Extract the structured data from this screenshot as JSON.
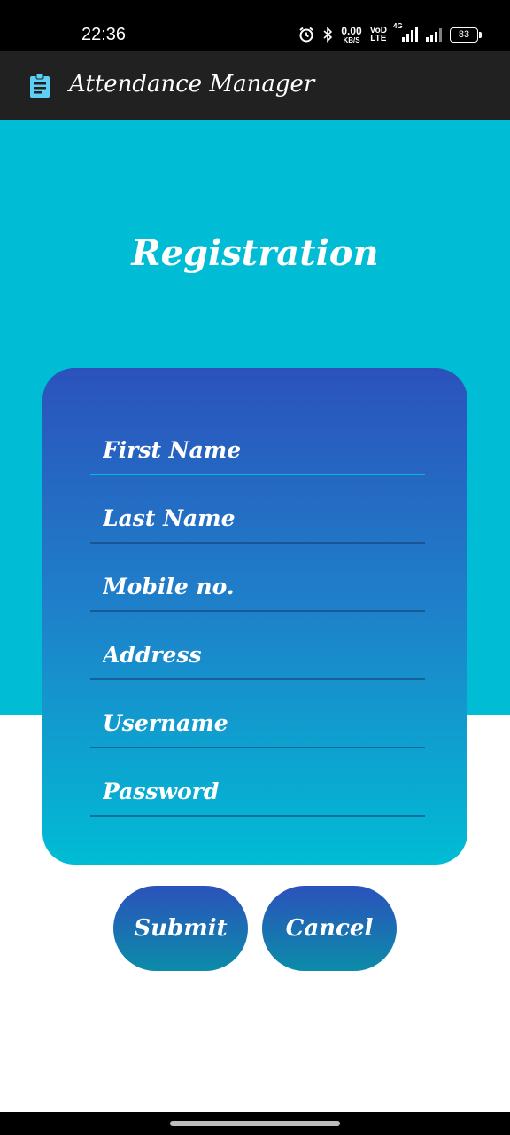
{
  "status_bar": {
    "time": "22:36",
    "net_speed_value": "0.00",
    "net_speed_unit": "KB/S",
    "volte_top": "VoD",
    "volte_bottom": "LTE",
    "network_type": "4G",
    "battery": "83"
  },
  "app_bar": {
    "title": "Attendance Manager",
    "icon": "clipboard-icon"
  },
  "screen": {
    "title": "Registration"
  },
  "form": {
    "fields": [
      {
        "placeholder": "First Name",
        "value": ""
      },
      {
        "placeholder": "Last Name",
        "value": ""
      },
      {
        "placeholder": "Mobile no.",
        "value": ""
      },
      {
        "placeholder": "Address",
        "value": ""
      },
      {
        "placeholder": "Username",
        "value": ""
      },
      {
        "placeholder": "Password",
        "value": ""
      }
    ]
  },
  "buttons": {
    "submit": "Submit",
    "cancel": "Cancel"
  },
  "colors": {
    "status_bar": "#000000",
    "app_bar": "#212121",
    "accent_cyan": "#00BCD4",
    "gradient_top": "#2B52BC",
    "background": "#FFFFFF"
  }
}
